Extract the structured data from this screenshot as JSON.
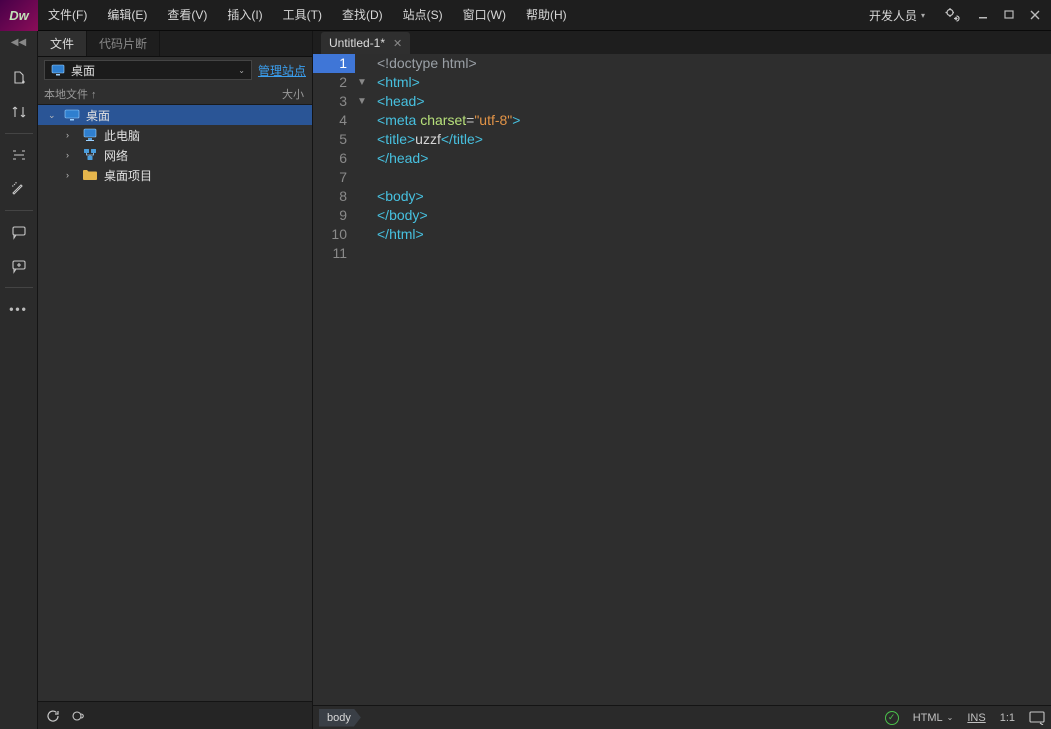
{
  "topbar": {
    "logo_text": "Dw",
    "menus": [
      "文件(F)",
      "编辑(E)",
      "查看(V)",
      "插入(I)",
      "工具(T)",
      "查找(D)",
      "站点(S)",
      "窗口(W)",
      "帮助(H)"
    ],
    "workspace_label": "开发人员"
  },
  "side_panel": {
    "tabs": {
      "files": "文件",
      "snippets": "代码片断"
    },
    "site_select": "桌面",
    "manage_site": "管理站点",
    "local_files_label": "本地文件",
    "size_label": "大小",
    "tree": {
      "root": "桌面",
      "children": [
        {
          "label": "此电脑"
        },
        {
          "label": "网络"
        },
        {
          "label": "桌面项目"
        }
      ]
    }
  },
  "editor": {
    "tab_title": "Untitled-1*",
    "code_lines": [
      {
        "n": 1,
        "kind": "doctype",
        "raw": "<!doctype html>"
      },
      {
        "n": 2,
        "kind": "open",
        "tag": "html",
        "fold": true
      },
      {
        "n": 3,
        "kind": "open",
        "tag": "head",
        "fold": true
      },
      {
        "n": 4,
        "kind": "meta",
        "tag": "meta",
        "attr": "charset",
        "val": "\"utf-8\""
      },
      {
        "n": 5,
        "kind": "title",
        "tag": "title",
        "text": "uzzf"
      },
      {
        "n": 6,
        "kind": "close",
        "tag": "head"
      },
      {
        "n": 7,
        "kind": "blank"
      },
      {
        "n": 8,
        "kind": "open",
        "tag": "body"
      },
      {
        "n": 9,
        "kind": "close",
        "tag": "body"
      },
      {
        "n": 10,
        "kind": "close",
        "tag": "html"
      },
      {
        "n": 11,
        "kind": "blank"
      }
    ],
    "breadcrumb": "body"
  },
  "statusbar": {
    "lang": "HTML",
    "overwrite": "INS",
    "pos": "1:1"
  }
}
